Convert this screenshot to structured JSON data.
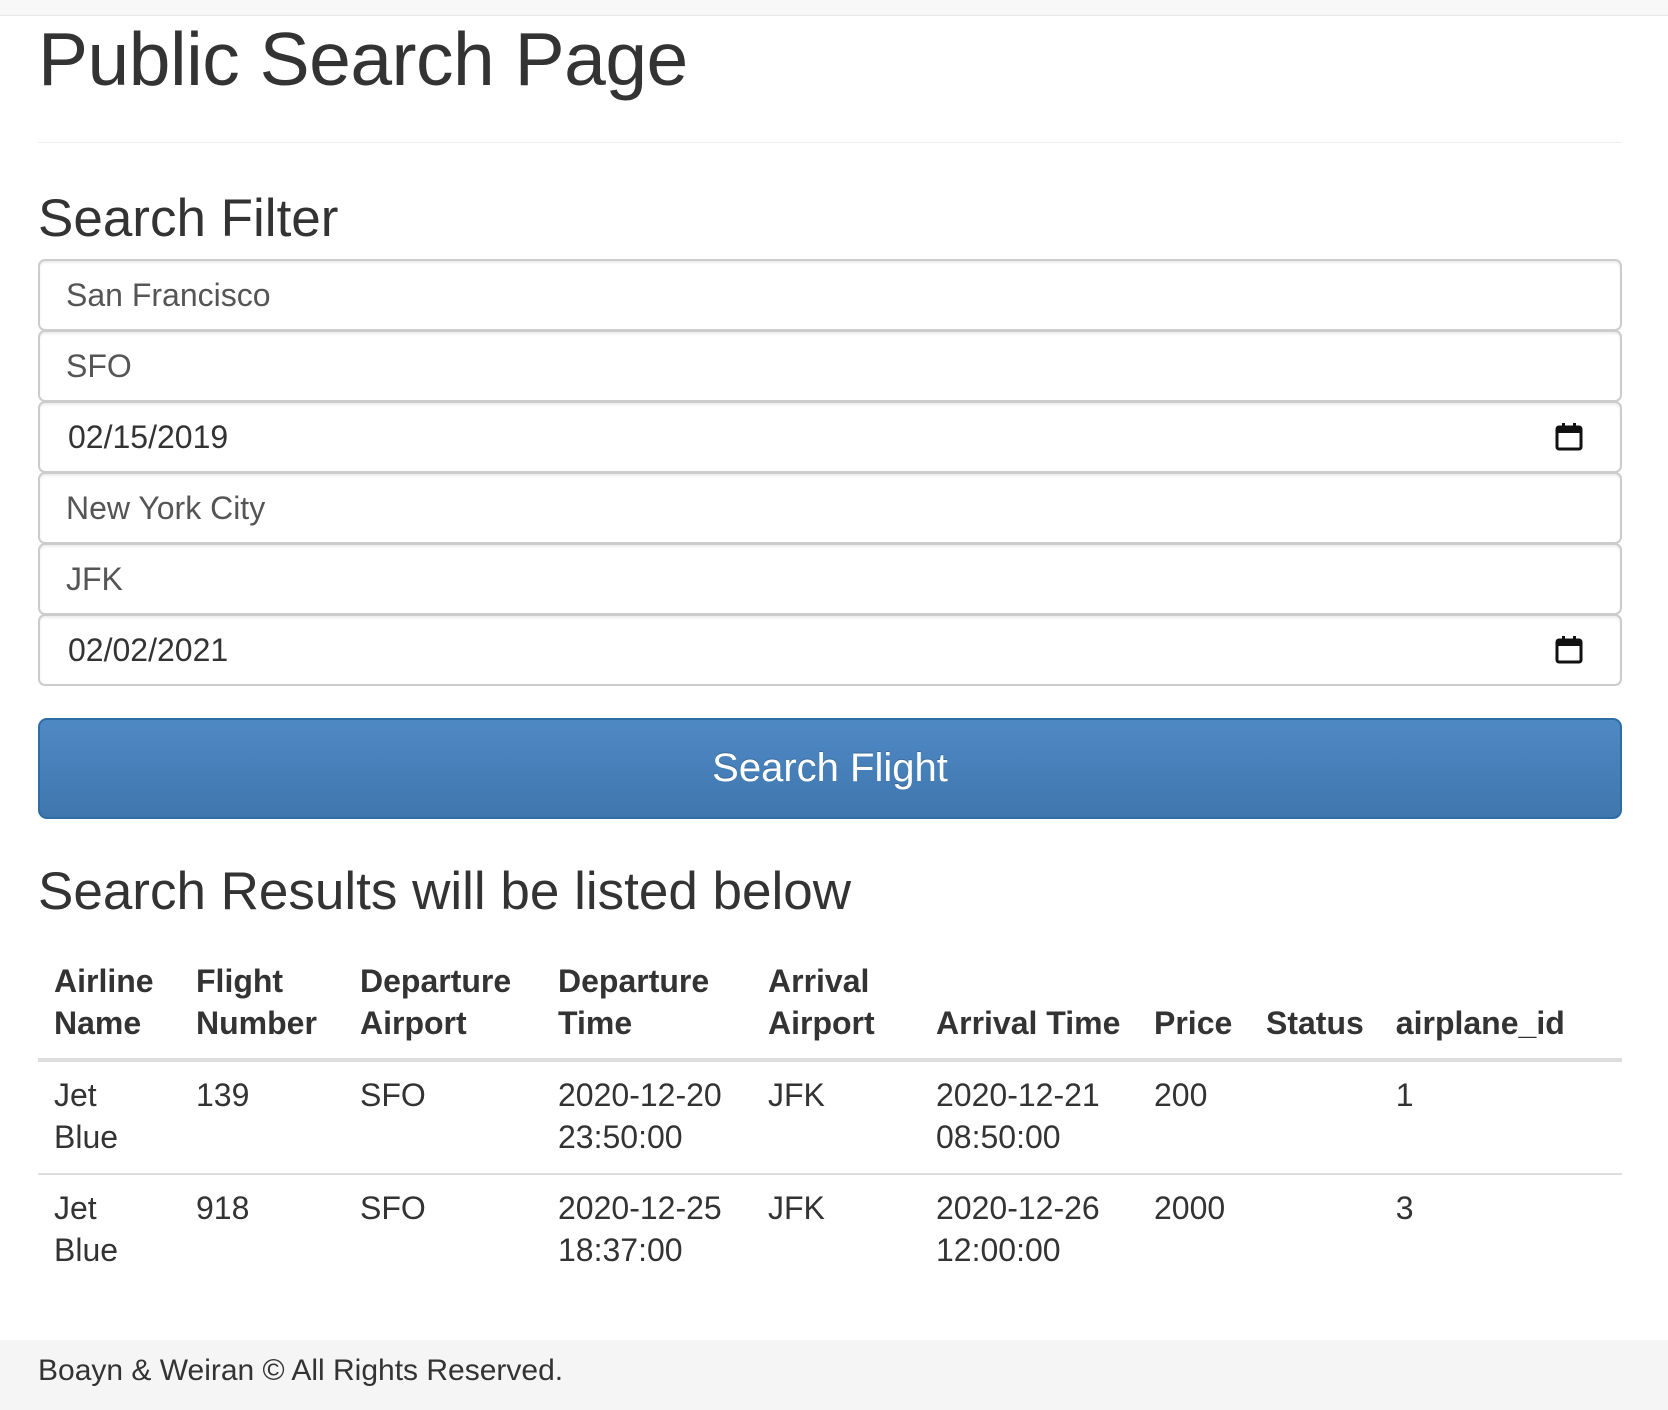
{
  "page": {
    "title": "Public Search Page"
  },
  "filter": {
    "heading": "Search Filter",
    "source_city": "San Francisco",
    "source_airport": "SFO",
    "departure_date": "02/15/2019",
    "destination_city": "New York City",
    "destination_airport": "JFK",
    "arrival_date": "02/02/2021",
    "calendar_icon": "calendar-icon",
    "submit_label": "Search Flight"
  },
  "results": {
    "heading": "Search Results will be listed below",
    "columns": [
      [
        "Airline",
        "Name"
      ],
      [
        "Flight",
        "Number"
      ],
      [
        "Departure",
        "Airport"
      ],
      [
        "Departure",
        "Time"
      ],
      [
        "Arrival",
        "Airport"
      ],
      [
        "Arrival Time"
      ],
      [
        "Price"
      ],
      [
        "Status"
      ],
      [
        "airplane_id"
      ]
    ],
    "rows": [
      {
        "airline_name": "Jet Blue",
        "flight_number": "139",
        "departure_airport": "SFO",
        "departure_date": "2020-12-20",
        "departure_clock": "23:50:00",
        "arrival_airport": "JFK",
        "arrival_date": "2020-12-21",
        "arrival_clock": "08:50:00",
        "price": "200",
        "status": "",
        "airplane_id": "1"
      },
      {
        "airline_name": "Jet Blue",
        "flight_number": "918",
        "departure_airport": "SFO",
        "departure_date": "2020-12-25",
        "departure_clock": "18:37:00",
        "arrival_airport": "JFK",
        "arrival_date": "2020-12-26",
        "arrival_clock": "12:00:00",
        "price": "2000",
        "status": "",
        "airplane_id": "3"
      }
    ]
  },
  "footer": {
    "text": "Boayn & Weiran © All Rights Reserved."
  },
  "colors": {
    "primary_button": "#4f89c5",
    "primary_button_border": "#2e6da4",
    "text": "#333333",
    "footer_background": "#f5f5f5"
  }
}
